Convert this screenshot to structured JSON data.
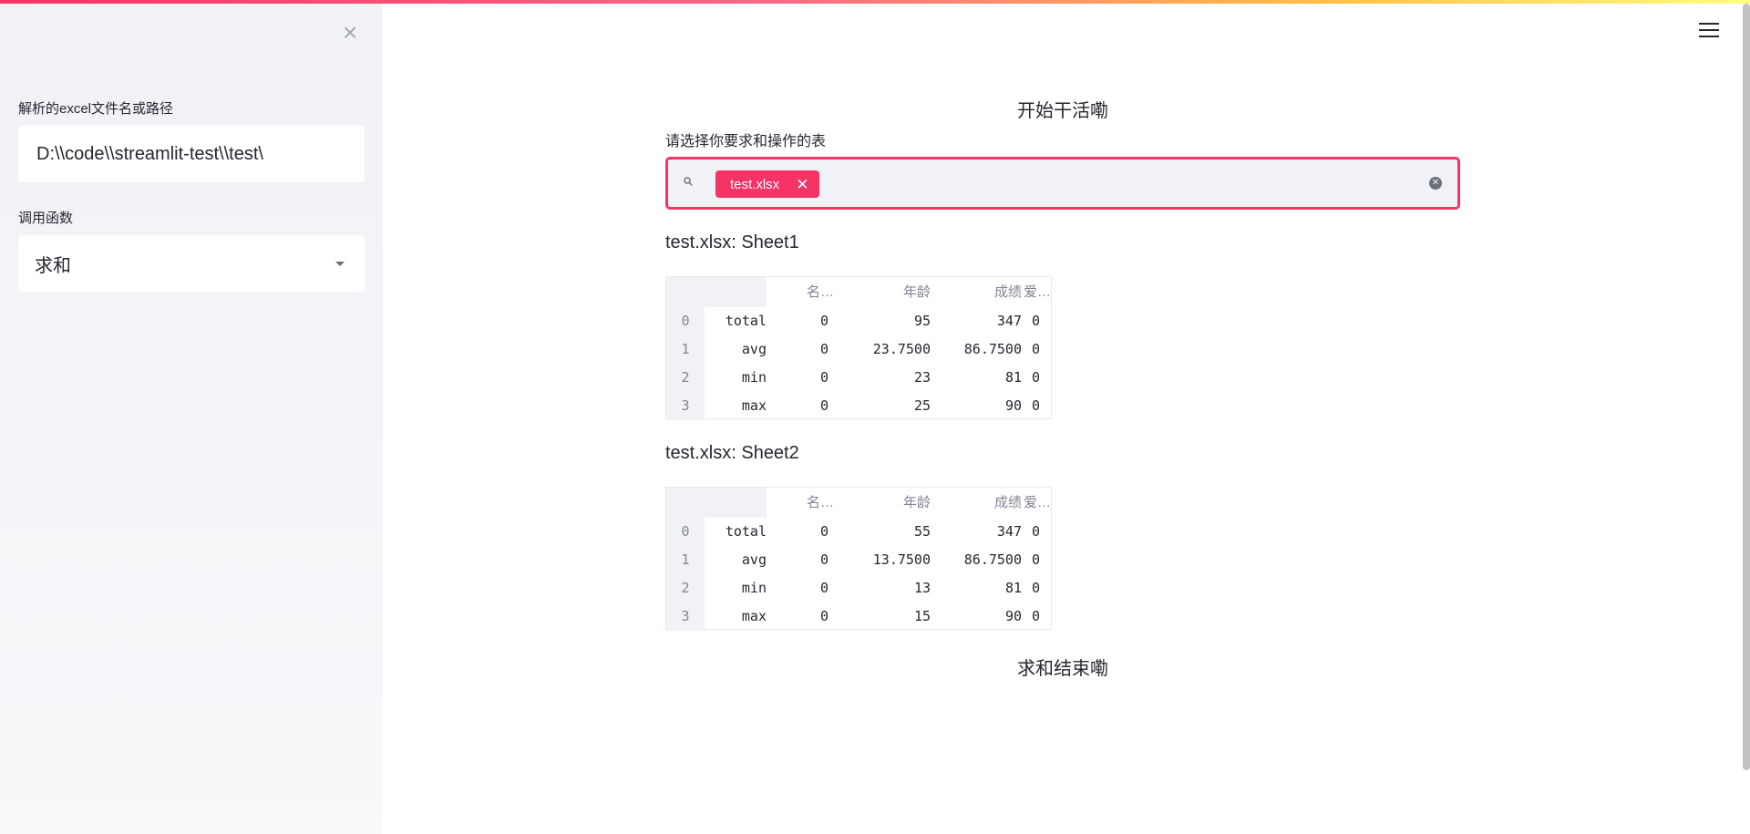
{
  "sidebar": {
    "close_icon": "×",
    "file_label": "解析的excel文件名或路径",
    "file_value": "D:\\\\code\\\\streamlit-test\\\\test\\",
    "func_label": "调用函数",
    "func_value": "求和"
  },
  "main": {
    "start_heading": "开始干活嘞",
    "select_label": "请选择你要求和操作的表",
    "selected_tag": "test.xlsx",
    "tag_remove": "✕",
    "end_heading": "求和结束嘞"
  },
  "columns": [
    "名…",
    "年龄",
    "成绩",
    "爱…"
  ],
  "sheets": [
    {
      "title": "test.xlsx: Sheet1",
      "rows": [
        {
          "idx": "0",
          "name": "total",
          "c1": "0",
          "age": "95",
          "score": "347",
          "c4": "0"
        },
        {
          "idx": "1",
          "name": "avg",
          "c1": "0",
          "age": "23.7500",
          "score": "86.7500",
          "c4": "0"
        },
        {
          "idx": "2",
          "name": "min",
          "c1": "0",
          "age": "23",
          "score": "81",
          "c4": "0"
        },
        {
          "idx": "3",
          "name": "max",
          "c1": "0",
          "age": "25",
          "score": "90",
          "c4": "0"
        }
      ]
    },
    {
      "title": "test.xlsx: Sheet2",
      "rows": [
        {
          "idx": "0",
          "name": "total",
          "c1": "0",
          "age": "55",
          "score": "347",
          "c4": "0"
        },
        {
          "idx": "1",
          "name": "avg",
          "c1": "0",
          "age": "13.7500",
          "score": "86.7500",
          "c4": "0"
        },
        {
          "idx": "2",
          "name": "min",
          "c1": "0",
          "age": "13",
          "score": "81",
          "c4": "0"
        },
        {
          "idx": "3",
          "name": "max",
          "c1": "0",
          "age": "15",
          "score": "90",
          "c4": "0"
        }
      ]
    }
  ],
  "colors": {
    "accent": "#f63366",
    "sidebar_bg": "#f0f2f6",
    "text": "#262730",
    "muted": "#808495"
  }
}
